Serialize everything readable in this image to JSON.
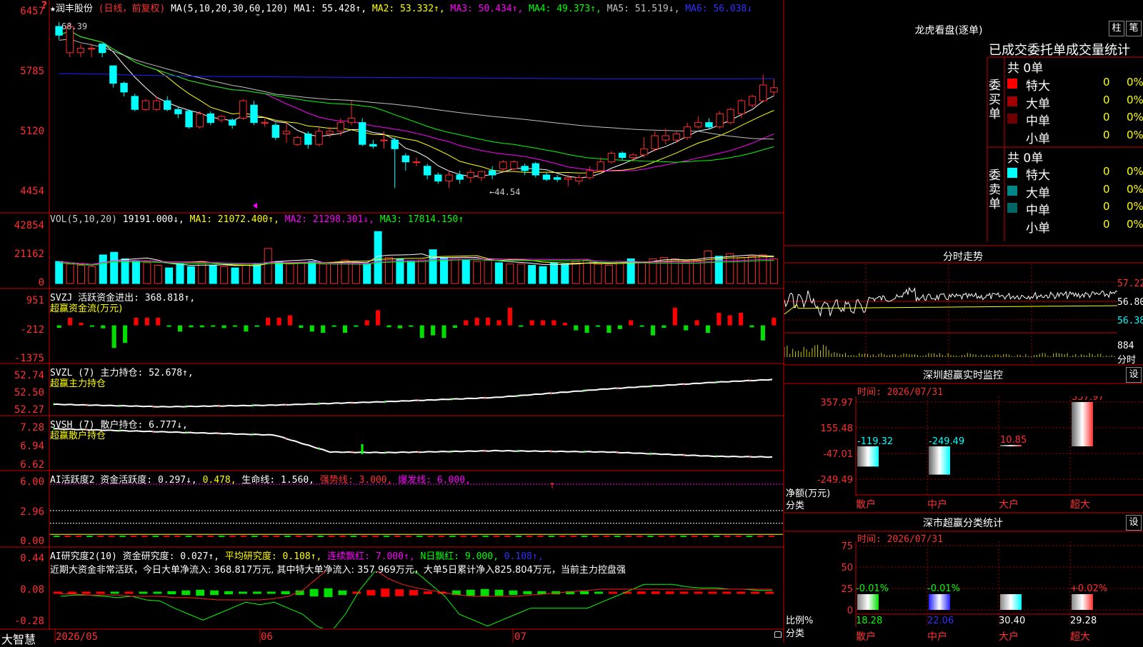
{
  "header": {
    "stock_name": "★润丰股份",
    "period_tag": "(日线，前复权)",
    "ma_label": "MA(5,10,20,30,60,120)",
    "ma1": "MA1: 55.428↑,",
    "ma2": "MA2: 53.332↑,",
    "ma3": "MA3: 50.434↑,",
    "ma4": "MA4: 49.373↑,",
    "ma5": "MA5: 51.519↓,",
    "ma6": "MA6: 56.038↓"
  },
  "colors": {
    "up": "#ff2a2a",
    "down": "#00ffff",
    "ma1": "#ffffff",
    "ma2": "#ffff00",
    "ma3": "#ff00ff",
    "ma4": "#00ff00",
    "ma5": "#c0c0c0",
    "ma6": "#2020ff"
  },
  "price_panel": {
    "yticks": [
      "6457",
      "5785",
      "5120",
      "4454"
    ],
    "high_label": "68.39",
    "low_label": "←44.54",
    "marker": "?"
  },
  "vol_panel": {
    "header": "VOL(5,10,20)",
    "value": "19191.000↓,",
    "ma1": "MA1: 21072.400↑,",
    "ma2": "MA2: 21298.301↓,",
    "ma3": "MA3: 17814.150↑",
    "yticks": [
      "42854",
      "21162",
      "0"
    ]
  },
  "svzj_panel": {
    "header": "SVZJ  活跃资金进出: 368.818↑,",
    "sub": "超赢资金流(万元)",
    "yticks": [
      "951",
      "-212",
      "-1375"
    ]
  },
  "svzl_panel": {
    "header": "SVZL (7) 主力持仓: 52.678↑,",
    "sub": "超赢主力持仓",
    "yticks": [
      "52.74",
      "52.50",
      "52.27"
    ]
  },
  "svsh_panel": {
    "header": "SVSH (7) 散户持仓: 6.777↓,",
    "sub": "超赢散户持仓",
    "yticks": [
      "7.28",
      "6.94",
      "6.62"
    ]
  },
  "ai1_panel": {
    "h1": "AI活跃度2 资金活跃度: 0.297↓,",
    "h2": "0.478,",
    "h3": "生命线: 1.560,",
    "h4": "强势线: 3.000,",
    "h5": "爆发线: 6.000,",
    "yticks": [
      "6.00",
      "2.96",
      "0.00"
    ]
  },
  "ai2_panel": {
    "h1": "AI研究度2(10) 资金研究度: 0.027↑,",
    "h2": "平均研究度: 0.108↑,",
    "h3": "连续飘红: 7.000↑,",
    "h4": "N日飘红: 9.000,",
    "h5": "0.108↑,",
    "summary": "近期大资金非常活跃，今日大单净流入: 368.817万元, 其中特大单净流入: 357.969万元，大单5日累计净入825.804万元，当前主力控盘强",
    "yticks": [
      "0.44",
      "0.08",
      "-0.28"
    ]
  },
  "x_axis": {
    "labels": [
      "2026/05",
      "06",
      "07"
    ],
    "brand": "大智慧"
  },
  "dragon_tiger": {
    "title": "龙虎看盘(逐单)",
    "btn1": "柱",
    "btn2": "笔",
    "subtitle": "已成交委托单成交量统计",
    "buy_label": "委买单",
    "buy_total": "共 0单",
    "sell_label": "委卖单",
    "sell_total": "共 0单",
    "buy_rows": [
      {
        "name": "特大",
        "count": "0",
        "pct": "0%",
        "color": "#ff0000"
      },
      {
        "name": "大单",
        "count": "0",
        "pct": "0%",
        "color": "#a00000"
      },
      {
        "name": "中单",
        "count": "0",
        "pct": "0%",
        "color": "#700000"
      },
      {
        "name": "小单",
        "count": "0",
        "pct": "0%",
        "color": "#000000"
      }
    ],
    "sell_rows": [
      {
        "name": "特大",
        "count": "0",
        "pct": "0%",
        "color": "#00ffff"
      },
      {
        "name": "大单",
        "count": "0",
        "pct": "0%",
        "color": "#008888"
      },
      {
        "name": "中单",
        "count": "0",
        "pct": "0%",
        "color": "#006666"
      },
      {
        "name": "小单",
        "count": "0",
        "pct": "0%",
        "color": "#000000"
      }
    ]
  },
  "intraday": {
    "title": "分时走势",
    "yticks": [
      "57.22",
      "56.80",
      "56.38"
    ],
    "vol_tick": "884",
    "vol_label": "分时"
  },
  "sz_monitor": {
    "title": "深圳超赢实时监控",
    "btn": "设",
    "time": "时间: 2026/07/31",
    "yticks": [
      "357.97",
      "155.48",
      "-47.01",
      "-249.49"
    ],
    "ylabel1": "净额(万元)",
    "ylabel2": "分类",
    "cats": [
      "散户",
      "中户",
      "大户",
      "超大"
    ],
    "values": [
      "-119.32",
      "-249.49",
      "10.85",
      "357.97"
    ]
  },
  "sz_class": {
    "title": "深市超赢分类统计",
    "btn": "设",
    "time": "时间: 2026/07/31",
    "yticks": [
      "75",
      "50",
      "25",
      "0"
    ],
    "ylabel1": "比例%",
    "ylabel2": "分类",
    "cats": [
      "散户",
      "中户",
      "大户",
      "超大"
    ],
    "top_labels": [
      "-0.01%",
      "-0.01%",
      "",
      "+0.02%"
    ],
    "values": [
      "18.28",
      "22.06",
      "30.40",
      "29.28"
    ]
  },
  "chart_data": [
    {
      "type": "candlestick",
      "yticks": [
        6457,
        5785,
        5120,
        4454
      ],
      "ylim": [
        4454,
        6457
      ],
      "bars": [
        {
          "o": 6350,
          "c": 6250,
          "h": 6400,
          "l": 6200
        },
        {
          "o": 6050,
          "c": 6350,
          "h": 6400,
          "l": 6000
        },
        {
          "o": 6050,
          "c": 6100,
          "h": 6150,
          "l": 6000
        },
        {
          "o": 6100,
          "c": 6100,
          "h": 6150,
          "l": 6000
        },
        {
          "o": 6150,
          "c": 6050,
          "h": 6150,
          "l": 6000
        },
        {
          "o": 5900,
          "c": 5700,
          "h": 5900,
          "l": 5650
        },
        {
          "o": 5700,
          "c": 5600,
          "h": 5720,
          "l": 5550
        },
        {
          "o": 5550,
          "c": 5400,
          "h": 5580,
          "l": 5380
        },
        {
          "o": 5400,
          "c": 5500,
          "h": 5520,
          "l": 5380
        },
        {
          "o": 5400,
          "c": 5500,
          "h": 5550,
          "l": 5380
        },
        {
          "o": 5500,
          "c": 5400,
          "h": 5550,
          "l": 5380
        },
        {
          "o": 5400,
          "c": 5350,
          "h": 5430,
          "l": 5300
        },
        {
          "o": 5380,
          "c": 5200,
          "h": 5400,
          "l": 5180
        },
        {
          "o": 5200,
          "c": 5350,
          "h": 5380,
          "l": 5180
        },
        {
          "o": 5350,
          "c": 5250,
          "h": 5380,
          "l": 5220
        },
        {
          "o": 5280,
          "c": 5320,
          "h": 5340,
          "l": 5250
        },
        {
          "o": 5280,
          "c": 5220,
          "h": 5300,
          "l": 5180
        },
        {
          "o": 5300,
          "c": 5500,
          "h": 5520,
          "l": 5280
        },
        {
          "o": 5450,
          "c": 5250,
          "h": 5500,
          "l": 5220
        },
        {
          "o": 5250,
          "c": 5250,
          "h": 5300,
          "l": 5200
        },
        {
          "o": 5220,
          "c": 5080,
          "h": 5250,
          "l": 5050
        },
        {
          "o": 5120,
          "c": 5150,
          "h": 5250,
          "l": 5020
        },
        {
          "o": 5000,
          "c": 5080,
          "h": 5100,
          "l": 4980
        },
        {
          "o": 5120,
          "c": 5000,
          "h": 5150,
          "l": 4950
        },
        {
          "o": 5000,
          "c": 5150,
          "h": 5200,
          "l": 4980
        },
        {
          "o": 5120,
          "c": 5150,
          "h": 5200,
          "l": 5080
        },
        {
          "o": 5150,
          "c": 5250,
          "h": 5300,
          "l": 5100
        },
        {
          "o": 5250,
          "c": 5300,
          "h": 5500,
          "l": 5220
        },
        {
          "o": 5250,
          "c": 5000,
          "h": 5300,
          "l": 4980
        },
        {
          "o": 5000,
          "c": 4980,
          "h": 5050,
          "l": 4950
        },
        {
          "o": 5050,
          "c": 5050,
          "h": 5150,
          "l": 4950
        },
        {
          "o": 5050,
          "c": 4950,
          "h": 5080,
          "l": 4500
        },
        {
          "o": 4870,
          "c": 4800,
          "h": 4900,
          "l": 4700
        },
        {
          "o": 4800,
          "c": 4800,
          "h": 4850,
          "l": 4750
        },
        {
          "o": 4750,
          "c": 4650,
          "h": 4780,
          "l": 4600
        },
        {
          "o": 4650,
          "c": 4580,
          "h": 4680,
          "l": 4550
        },
        {
          "o": 4580,
          "c": 4650,
          "h": 4700,
          "l": 4500
        },
        {
          "o": 4650,
          "c": 4600,
          "h": 4700,
          "l": 4550
        },
        {
          "o": 4620,
          "c": 4680,
          "h": 4720,
          "l": 4560
        },
        {
          "o": 4620,
          "c": 4690,
          "h": 4700,
          "l": 4580
        },
        {
          "o": 4700,
          "c": 4650,
          "h": 4750,
          "l": 4600
        },
        {
          "o": 4720,
          "c": 4800,
          "h": 4820,
          "l": 4680
        },
        {
          "o": 4720,
          "c": 4800,
          "h": 4820,
          "l": 4700
        },
        {
          "o": 4750,
          "c": 4700,
          "h": 4780,
          "l": 4650
        },
        {
          "o": 4780,
          "c": 4650,
          "h": 4800,
          "l": 4620
        },
        {
          "o": 4650,
          "c": 4600,
          "h": 4680,
          "l": 4580
        },
        {
          "o": 4620,
          "c": 4600,
          "h": 4650,
          "l": 4570
        },
        {
          "o": 4600,
          "c": 4620,
          "h": 4650,
          "l": 4520
        },
        {
          "o": 4580,
          "c": 4620,
          "h": 4650,
          "l": 4540
        },
        {
          "o": 4620,
          "c": 4700,
          "h": 4750,
          "l": 4600
        },
        {
          "o": 4700,
          "c": 4800,
          "h": 4850,
          "l": 4680
        },
        {
          "o": 4800,
          "c": 4900,
          "h": 4920,
          "l": 4780
        },
        {
          "o": 4900,
          "c": 4850,
          "h": 4920,
          "l": 4820
        },
        {
          "o": 4850,
          "c": 4880,
          "h": 4900,
          "l": 4800
        },
        {
          "o": 4880,
          "c": 4950,
          "h": 5080,
          "l": 4850
        },
        {
          "o": 4950,
          "c": 5100,
          "h": 5150,
          "l": 4920
        },
        {
          "o": 5050,
          "c": 5100,
          "h": 5180,
          "l": 5000
        },
        {
          "o": 5050,
          "c": 5120,
          "h": 5150,
          "l": 5020
        },
        {
          "o": 5080,
          "c": 5200,
          "h": 5250,
          "l": 5050
        },
        {
          "o": 5200,
          "c": 5250,
          "h": 5320,
          "l": 5180
        },
        {
          "o": 5250,
          "c": 5200,
          "h": 5300,
          "l": 5170
        },
        {
          "o": 5200,
          "c": 5350,
          "h": 5380,
          "l": 5180
        },
        {
          "o": 5250,
          "c": 5400,
          "h": 5420,
          "l": 5230
        },
        {
          "o": 5350,
          "c": 5500,
          "h": 5520,
          "l": 5300
        },
        {
          "o": 5450,
          "c": 5550,
          "h": 5570,
          "l": 5420
        },
        {
          "o": 5500,
          "c": 5680,
          "h": 5800,
          "l": 5480
        },
        {
          "o": 5600,
          "c": 5650,
          "h": 5750,
          "l": 5560
        }
      ]
    },
    {
      "type": "bar",
      "name": "VOL",
      "yticks": [
        42854,
        21162,
        0
      ],
      "ylim": [
        0,
        42854
      ],
      "values": [
        17000,
        15000,
        14000,
        13000,
        22000,
        24000,
        19000,
        17000,
        16000,
        14000,
        12000,
        15000,
        13000,
        17000,
        14000,
        13000,
        12000,
        14000,
        15000,
        27000,
        17000,
        15000,
        16000,
        17000,
        15000,
        16000,
        18000,
        16000,
        15000,
        40000,
        20000,
        19000,
        17000,
        18000,
        26000,
        20000,
        19000,
        18000,
        17000,
        18000,
        16000,
        15000,
        15000,
        14000,
        13000,
        16000,
        15000,
        17000,
        18000,
        15000,
        14000,
        17000,
        19000,
        16000,
        19000,
        20000,
        19000,
        17000,
        18000,
        25000,
        21000,
        23000,
        20000,
        21000,
        22000,
        19000
      ]
    },
    {
      "type": "bar",
      "name": "SVZJ",
      "yticks": [
        951,
        -212,
        -1375
      ],
      "ylim": [
        -1375,
        951
      ],
      "values": [
        -100,
        300,
        100,
        -60,
        -120,
        -900,
        -700,
        300,
        300,
        300,
        -60,
        -250,
        -80,
        -80,
        -60,
        -110,
        -60,
        -250,
        -60,
        300,
        300,
        400,
        -100,
        -250,
        -300,
        -60,
        -300,
        -60,
        200,
        600,
        -80,
        -120,
        -60,
        -500,
        -400,
        -500,
        -100,
        200,
        300,
        300,
        200,
        700,
        -60,
        200,
        200,
        200,
        100,
        -200,
        -300,
        -60,
        -300,
        -150,
        200,
        -60,
        -400,
        -100,
        700,
        -200,
        200,
        -300,
        500,
        400,
        500,
        -80,
        -600,
        300
      ]
    },
    {
      "type": "line",
      "name": "SVZL",
      "yticks": [
        52.74,
        52.5,
        52.27
      ],
      "ylim": [
        52.27,
        52.74
      ],
      "x": [
        0,
        10,
        20,
        30,
        40,
        50,
        60,
        65
      ],
      "values": [
        52.37,
        52.34,
        52.36,
        52.4,
        52.45,
        52.55,
        52.63,
        52.66
      ]
    },
    {
      "type": "line",
      "name": "SVSH",
      "yticks": [
        7.28,
        6.94,
        6.62
      ],
      "ylim": [
        6.62,
        7.28
      ],
      "x": [
        0,
        10,
        20,
        25,
        30,
        40,
        50,
        60,
        65
      ],
      "values": [
        7.23,
        7.18,
        7.13,
        6.86,
        6.85,
        6.88,
        6.86,
        6.79,
        6.78
      ]
    },
    {
      "type": "line",
      "name": "AI活跃度2",
      "yticks": [
        6,
        2.96,
        0
      ],
      "ylim": [
        0,
        6
      ],
      "strong": 3,
      "burst": 6,
      "life": 1.56
    },
    {
      "type": "line",
      "name": "AI研究度2",
      "yticks": [
        0.44,
        0.08,
        -0.28
      ],
      "ylim": [
        -0.28,
        0.44
      ],
      "values": [
        0.05,
        0.06,
        0.06,
        0.05,
        0.04,
        0.05,
        0.02,
        0.01,
        -0.05,
        -0.1,
        -0.15,
        -0.1,
        -0.05,
        0.0,
        -0.02,
        0.0,
        -0.05,
        -0.1,
        -0.2,
        -0.25,
        -0.1,
        0.1,
        0.25,
        0.35,
        0.3,
        0.25,
        0.15,
        0.05,
        -0.1,
        -0.15,
        -0.2,
        -0.15,
        -0.1,
        -0.05,
        -0.05,
        -0.05,
        -0.05,
        -0.05,
        0.0,
        0.05,
        0.1,
        0.15,
        0.15,
        0.15,
        0.13,
        0.12,
        0.12,
        0.11,
        0.11,
        0.1,
        0.1
      ],
      "avg": [
        0.07,
        0.07,
        0.06,
        0.06,
        0.06,
        0.05,
        0.05,
        0.05,
        0.04,
        0.04,
        0.03,
        0.02,
        0.02,
        0.02,
        0.02,
        0.03,
        0.05,
        0.1,
        0.2,
        0.3,
        0.35,
        0.33,
        0.28,
        0.2,
        0.15,
        0.12,
        0.1,
        0.08,
        0.06,
        0.05,
        0.05,
        0.05,
        0.05,
        0.06,
        0.07,
        0.08,
        0.09,
        0.1,
        0.11,
        0.11,
        0.11,
        0.11,
        0.11,
        0.11,
        0.11,
        0.11,
        0.11,
        0.11,
        0.11,
        0.11,
        0.11
      ]
    }
  ]
}
